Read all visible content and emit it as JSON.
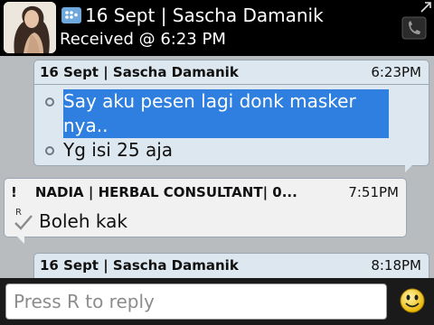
{
  "header": {
    "title": "16 Sept | Sascha Damanik",
    "status": "Received @ 6:23 PM"
  },
  "messages": [
    {
      "sender": "16 Sept | Sascha Damanik",
      "time": "6:23PM",
      "lines": [
        "Say aku pesen lagi donk masker nya..",
        "Yg isi 25 aja"
      ],
      "highlighted_line": 0
    },
    {
      "prefix": "!",
      "sender": "NADIA | HERBAL CONSULTANT| 0...",
      "time": "7:51PM",
      "read_marker": "R",
      "lines": [
        "Boleh kak"
      ]
    },
    {
      "sender": "16 Sept | Sascha Damanik",
      "time": "8:18PM"
    }
  ],
  "reply": {
    "placeholder": "Press R to reply"
  },
  "icons": {
    "avatar": "contact-avatar",
    "bbm": "bbm-icon",
    "phone": "phone-icon",
    "expand": "expand-icon",
    "emoticon": "smiley-icon",
    "delivered": "checkmark-icon"
  },
  "colors": {
    "header_bg": "#000000",
    "outgoing_bubble": "#dde7ef",
    "incoming_bubble": "#f1f1f1",
    "selection": "#2e7fdf",
    "background": "#b9bcbf"
  }
}
